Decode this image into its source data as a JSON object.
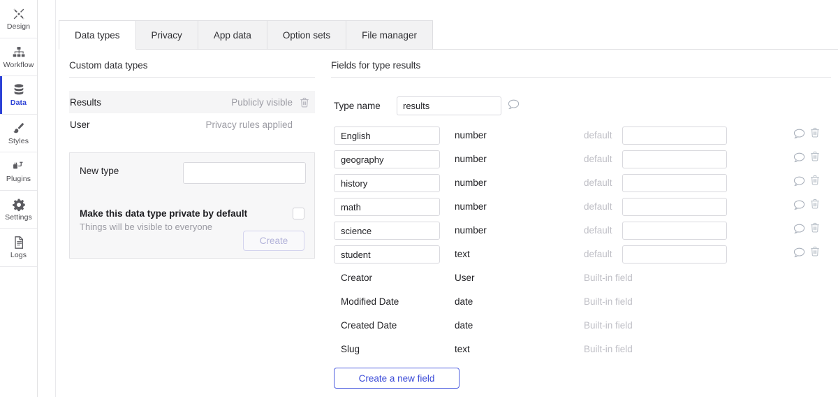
{
  "sidebar": {
    "items": [
      {
        "label": "Design",
        "icon": "design-tools-icon",
        "active": false
      },
      {
        "label": "Workflow",
        "icon": "workflow-icon",
        "active": false
      },
      {
        "label": "Data",
        "icon": "database-icon",
        "active": true
      },
      {
        "label": "Styles",
        "icon": "paintbrush-icon",
        "active": false
      },
      {
        "label": "Plugins",
        "icon": "plugins-icon",
        "active": false
      },
      {
        "label": "Settings",
        "icon": "gear-icon",
        "active": false
      },
      {
        "label": "Logs",
        "icon": "document-icon",
        "active": false
      }
    ]
  },
  "tabs": [
    {
      "label": "Data types",
      "active": true
    },
    {
      "label": "Privacy",
      "active": false
    },
    {
      "label": "App data",
      "active": false
    },
    {
      "label": "Option sets",
      "active": false
    },
    {
      "label": "File manager",
      "active": false
    }
  ],
  "left_panel": {
    "title": "Custom data types",
    "types": [
      {
        "name": "Results",
        "meta": "Publicly visible",
        "selected": true,
        "has_trash": true
      },
      {
        "name": "User",
        "meta": "Privacy rules applied",
        "selected": false,
        "has_trash": false
      }
    ],
    "new_type": {
      "label": "New type",
      "input_value": "",
      "input_placeholder": "",
      "checkbox_label": "Make this data type private by default",
      "checkbox_sublabel": "Things will be visible to everyone",
      "checkbox_checked": false,
      "create_label": "Create"
    }
  },
  "right_panel": {
    "title": "Fields for type results",
    "type_name_label": "Type name",
    "type_name_value": "results",
    "create_field_label": "Create a new field",
    "default_label": "default",
    "builtin_label": "Built-in field",
    "fields": [
      {
        "name": "English",
        "type": "number",
        "editable": true,
        "default_label": "default",
        "has_default_input": true,
        "has_icons": true
      },
      {
        "name": "geography",
        "type": "number",
        "editable": true,
        "default_label": "default",
        "has_default_input": true,
        "has_icons": true
      },
      {
        "name": "history",
        "type": "number",
        "editable": true,
        "default_label": "default",
        "has_default_input": true,
        "has_icons": true
      },
      {
        "name": "math",
        "type": "number",
        "editable": true,
        "default_label": "default",
        "has_default_input": true,
        "has_icons": true
      },
      {
        "name": "science",
        "type": "number",
        "editable": true,
        "default_label": "default",
        "has_default_input": true,
        "has_icons": true
      },
      {
        "name": "student",
        "type": "text",
        "editable": true,
        "default_label": "default",
        "has_default_input": true,
        "has_icons": true
      },
      {
        "name": "Creator",
        "type": "User",
        "editable": false,
        "default_label": "Built-in field",
        "has_default_input": false,
        "has_icons": false
      },
      {
        "name": "Modified Date",
        "type": "date",
        "editable": false,
        "default_label": "Built-in field",
        "has_default_input": false,
        "has_icons": false
      },
      {
        "name": "Created Date",
        "type": "date",
        "editable": false,
        "default_label": "Built-in field",
        "has_default_input": false,
        "has_icons": false
      },
      {
        "name": "Slug",
        "type": "text",
        "editable": false,
        "default_label": "Built-in field",
        "has_default_input": false,
        "has_icons": false
      }
    ]
  },
  "colors": {
    "accent": "#2c41d6",
    "accent_button_border": "#4f5fe0",
    "muted_text": "#9b9ba3",
    "panel_bg": "#f7f7f8",
    "selected_row_bg": "#f5f5f6",
    "tab_inactive_bg": "#f2f2f3",
    "border": "#dfdfe2"
  }
}
